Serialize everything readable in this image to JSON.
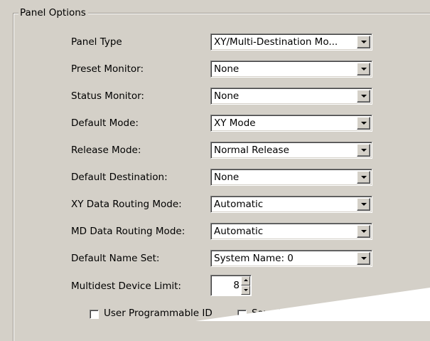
{
  "group": {
    "title": "Panel Options"
  },
  "fields": [
    {
      "label": "Panel Type",
      "value": "XY/Multi-Destination Mo..."
    },
    {
      "label": "Preset Monitor:",
      "value": "None"
    },
    {
      "label": "Status Monitor:",
      "value": "None"
    },
    {
      "label": "Default Mode:",
      "value": "XY Mode"
    },
    {
      "label": "Release Mode:",
      "value": "Normal Release"
    },
    {
      "label": "Default Destination:",
      "value": "None"
    },
    {
      "label": "XY Data Routing Mode:",
      "value": "Automatic"
    },
    {
      "label": "MD Data Routing Mode:",
      "value": "Automatic"
    },
    {
      "label": "Default Name Set:",
      "value": "System Name: 0"
    }
  ],
  "multidest": {
    "label": "Multidest Device Limit:",
    "value": "8"
  },
  "checkboxes": [
    {
      "label": "User Programmable ID",
      "checked": false
    },
    {
      "label": "Save Preset Defaults",
      "checked": false
    }
  ]
}
